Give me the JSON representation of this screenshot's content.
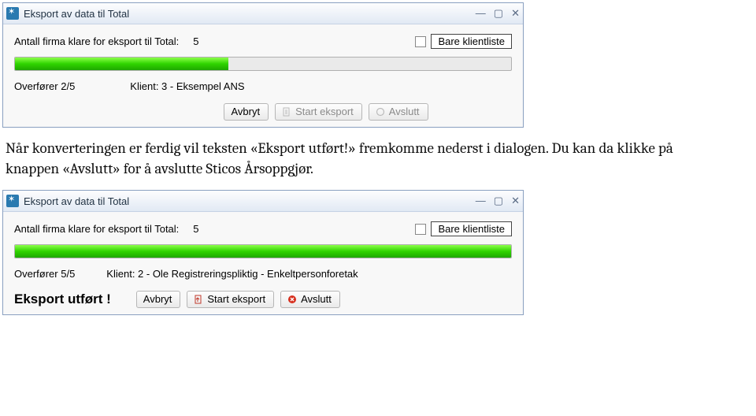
{
  "dialog1": {
    "title": "Eksport av data til Total",
    "count_label": "Antall firma klare for eksport til Total:",
    "count_value": "5",
    "klient_check_label": "Bare klientliste",
    "progress_pct": 43,
    "transfer_label": "Overfører 2/5",
    "client_label": "Klient: 3 - Eksempel ANS",
    "btn_cancel": "Avbryt",
    "btn_start": "Start eksport",
    "btn_close": "Avslutt"
  },
  "caption": "Når konverteringen er ferdig vil teksten «Eksport utført!» fremkomme nederst i dialogen. Du kan da klikke på knappen «Avslutt» for å avslutte Sticos Årsoppgjør.",
  "dialog2": {
    "title": "Eksport av data til Total",
    "count_label": "Antall firma klare for eksport til Total:",
    "count_value": "5",
    "klient_check_label": "Bare klientliste",
    "progress_pct": 100,
    "transfer_label": "Overfører 5/5",
    "client_label": "Klient: 2 - Ole Registreringspliktig - Enkeltpersonforetak",
    "done_status": "Eksport utført !",
    "btn_cancel": "Avbryt",
    "btn_start": "Start eksport",
    "btn_close": "Avslutt"
  }
}
